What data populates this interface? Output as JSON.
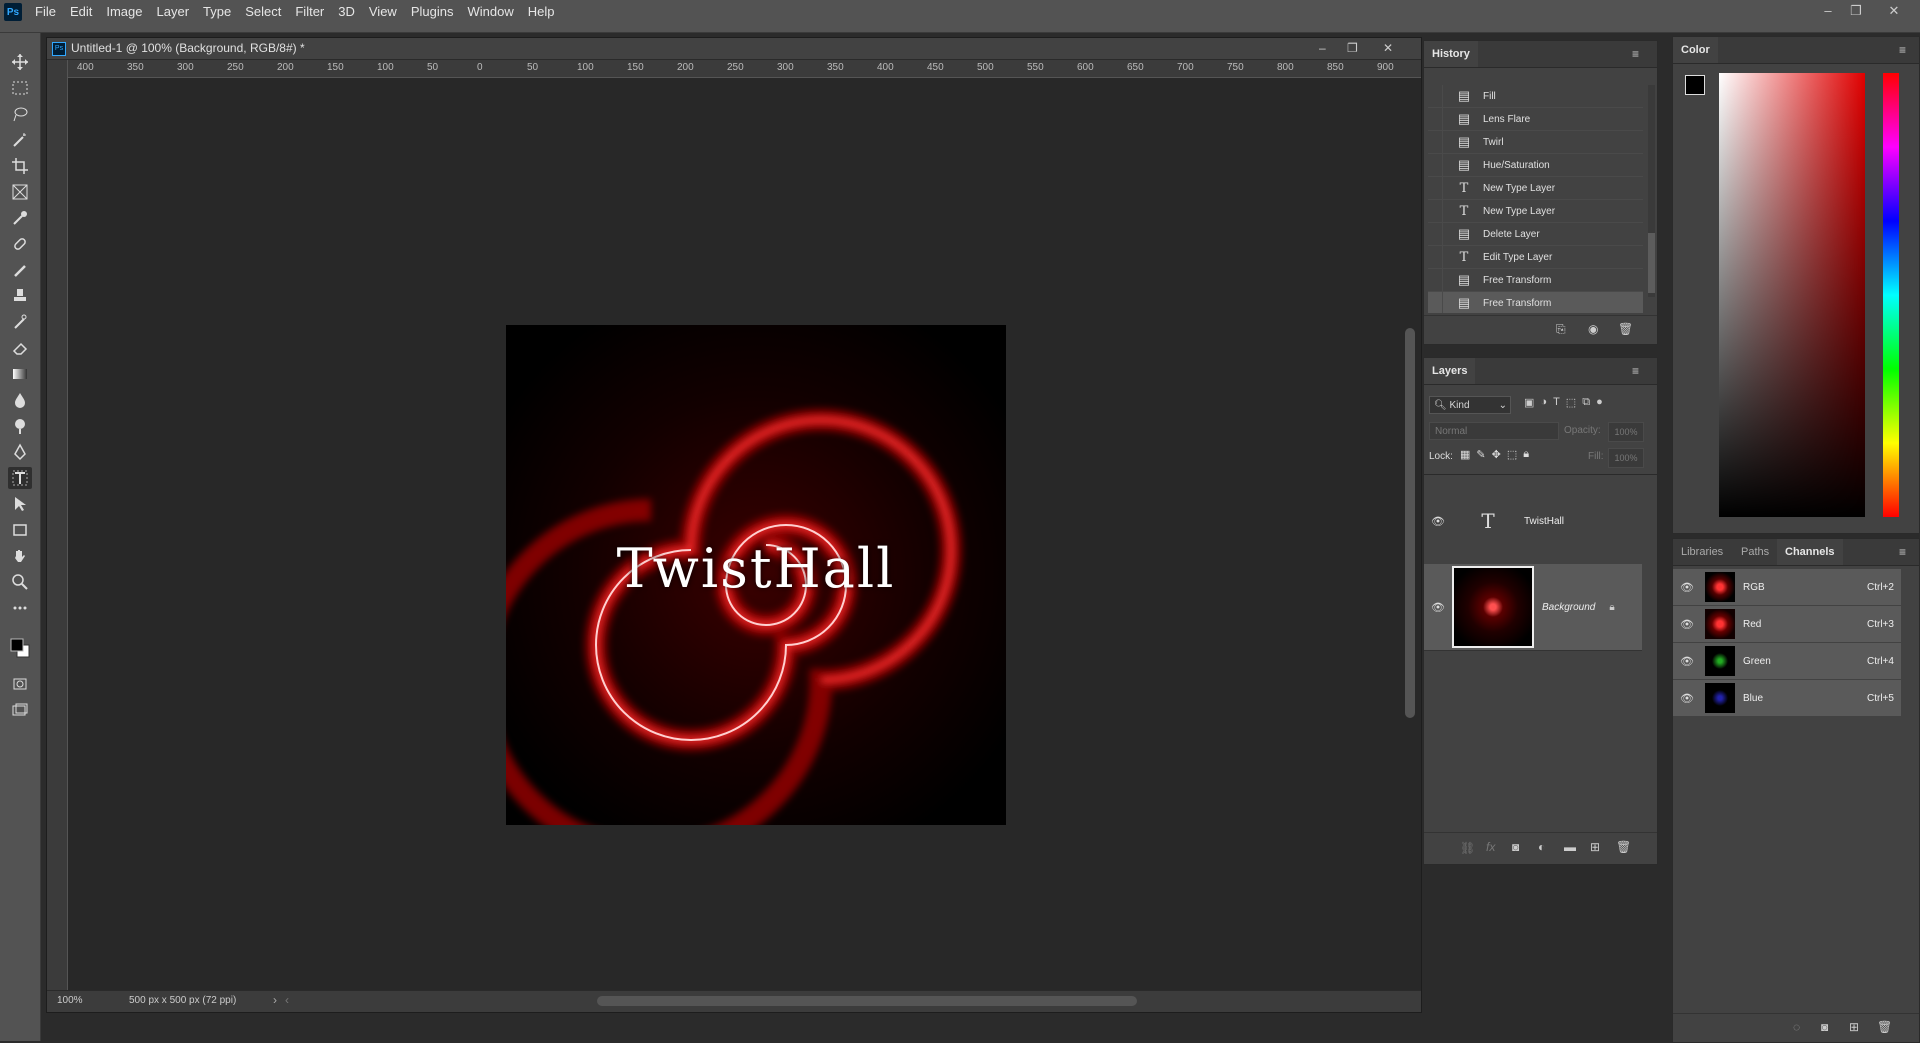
{
  "app": {
    "logo": "Ps"
  },
  "menu": [
    "File",
    "Edit",
    "Image",
    "Layer",
    "Type",
    "Select",
    "Filter",
    "3D",
    "View",
    "Plugins",
    "Window",
    "Help"
  ],
  "window_controls": {
    "minimize": "–",
    "restore": "❐",
    "close": "✕"
  },
  "document": {
    "title": "Untitled-1 @ 100% (Background, RGB/8#) *",
    "zoom": "100%",
    "size_info": "500 px x 500 px (72 ppi)",
    "artwork_text": "TwistHall",
    "ruler_labels": [
      "400",
      "350",
      "300",
      "250",
      "200",
      "150",
      "100",
      "50",
      "0",
      "50",
      "100",
      "150",
      "200",
      "250",
      "300",
      "350",
      "400",
      "450",
      "500",
      "550",
      "600",
      "650",
      "700",
      "750",
      "800",
      "850",
      "900"
    ]
  },
  "history": {
    "title": "History",
    "items": [
      {
        "label": "Fill",
        "icon": "doc-icon"
      },
      {
        "label": "Lens Flare",
        "icon": "doc-icon"
      },
      {
        "label": "Twirl",
        "icon": "doc-icon"
      },
      {
        "label": "Hue/Saturation",
        "icon": "doc-icon"
      },
      {
        "label": "New Type Layer",
        "icon": "type-icon"
      },
      {
        "label": "New Type Layer",
        "icon": "type-icon"
      },
      {
        "label": "Delete Layer",
        "icon": "doc-icon"
      },
      {
        "label": "Edit Type Layer",
        "icon": "type-icon"
      },
      {
        "label": "Free Transform",
        "icon": "doc-icon"
      },
      {
        "label": "Free Transform",
        "icon": "doc-icon"
      }
    ]
  },
  "layers": {
    "title": "Layers",
    "filter": "Kind",
    "blend_mode": "Normal",
    "opacity_label": "Opacity:",
    "opacity_value": "100%",
    "lock_label": "Lock:",
    "fill_label": "Fill:",
    "fill_value": "100%",
    "items": [
      {
        "name": "TwistHall",
        "type": "text"
      },
      {
        "name": "Background",
        "type": "image"
      }
    ]
  },
  "color": {
    "title": "Color"
  },
  "channels_panel": {
    "tabs": [
      "Libraries",
      "Paths",
      "Channels"
    ],
    "items": [
      {
        "name": "RGB",
        "shortcut": "Ctrl+2"
      },
      {
        "name": "Red",
        "shortcut": "Ctrl+3"
      },
      {
        "name": "Green",
        "shortcut": "Ctrl+4"
      },
      {
        "name": "Blue",
        "shortcut": "Ctrl+5"
      }
    ]
  },
  "colors": {
    "accent": "#ff2020",
    "panel": "#424242",
    "chrome": "#535353"
  }
}
